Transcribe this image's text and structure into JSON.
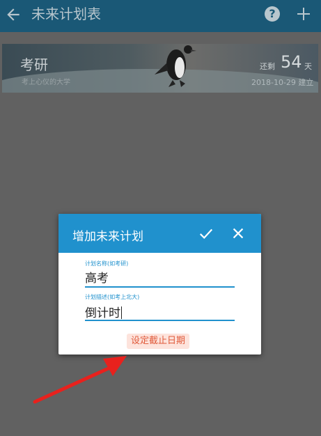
{
  "appbar": {
    "title": "未来计划表",
    "back_icon": "arrow-left-icon",
    "help_icon": "help-circle-icon",
    "add_icon": "plus-icon",
    "help_glyph": "?"
  },
  "plan_card": {
    "name": "考研",
    "description": "考上心仪的大学",
    "remain_label": "还剩",
    "remain_days": "54",
    "remain_unit": "天",
    "created": "2018-10-29 建立"
  },
  "dialog": {
    "title": "增加未来计划",
    "confirm_icon": "check-icon",
    "close_icon": "close-icon",
    "name_label": "计划名称(如考研)",
    "name_value": "高考",
    "desc_label": "计划描述(如考上北大)",
    "desc_value": "倒计时",
    "deadline_button": "设定截止日期"
  },
  "colors": {
    "appbar": "#1a5876",
    "dialog_header": "#2091cd",
    "accent": "#2091cd",
    "deadline_text": "#e05a3a",
    "annotation_arrow": "#e8211d"
  }
}
